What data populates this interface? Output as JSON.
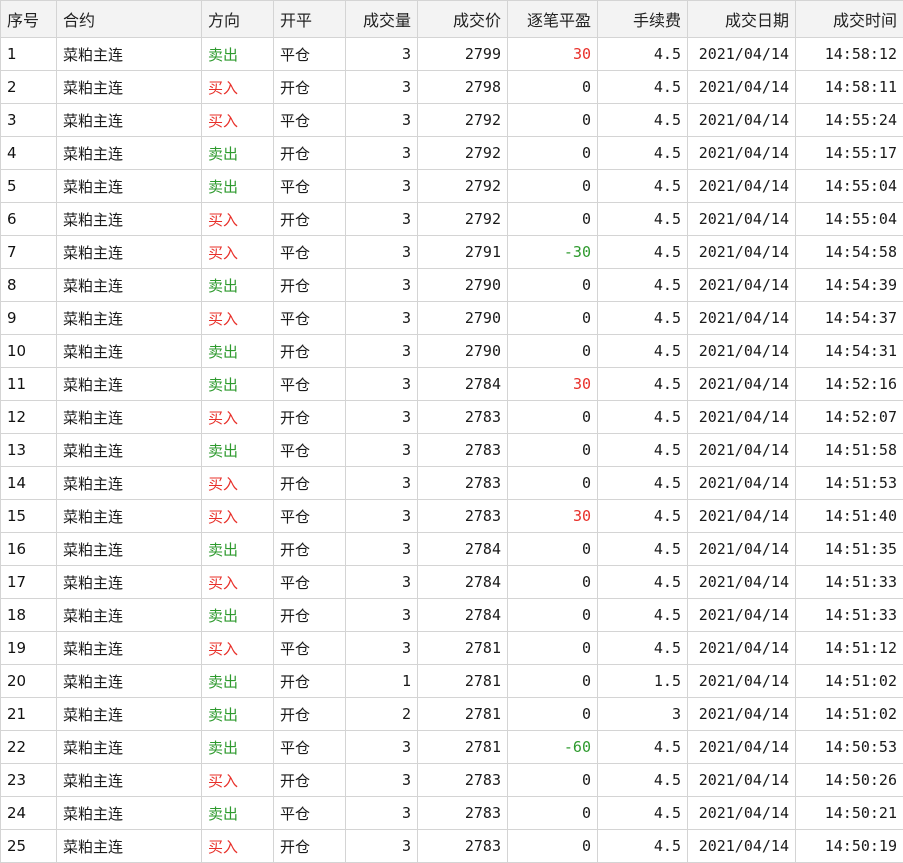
{
  "columns": [
    "序号",
    "合约",
    "方向",
    "开平",
    "成交量",
    "成交价",
    "逐笔平盈",
    "手续费",
    "成交日期",
    "成交时间"
  ],
  "colors": {
    "buy": "#e8302a",
    "sell": "#2e9a2e"
  },
  "rows": [
    {
      "seq": "1",
      "contract": "菜粕主连",
      "dir": "卖出",
      "oc": "平仓",
      "vol": "3",
      "price": "2799",
      "pnl": "30",
      "fee": "4.5",
      "date": "2021/04/14",
      "time": "14:58:12"
    },
    {
      "seq": "2",
      "contract": "菜粕主连",
      "dir": "买入",
      "oc": "开仓",
      "vol": "3",
      "price": "2798",
      "pnl": "0",
      "fee": "4.5",
      "date": "2021/04/14",
      "time": "14:58:11"
    },
    {
      "seq": "3",
      "contract": "菜粕主连",
      "dir": "买入",
      "oc": "平仓",
      "vol": "3",
      "price": "2792",
      "pnl": "0",
      "fee": "4.5",
      "date": "2021/04/14",
      "time": "14:55:24"
    },
    {
      "seq": "4",
      "contract": "菜粕主连",
      "dir": "卖出",
      "oc": "开仓",
      "vol": "3",
      "price": "2792",
      "pnl": "0",
      "fee": "4.5",
      "date": "2021/04/14",
      "time": "14:55:17"
    },
    {
      "seq": "5",
      "contract": "菜粕主连",
      "dir": "卖出",
      "oc": "平仓",
      "vol": "3",
      "price": "2792",
      "pnl": "0",
      "fee": "4.5",
      "date": "2021/04/14",
      "time": "14:55:04"
    },
    {
      "seq": "6",
      "contract": "菜粕主连",
      "dir": "买入",
      "oc": "开仓",
      "vol": "3",
      "price": "2792",
      "pnl": "0",
      "fee": "4.5",
      "date": "2021/04/14",
      "time": "14:55:04"
    },
    {
      "seq": "7",
      "contract": "菜粕主连",
      "dir": "买入",
      "oc": "平仓",
      "vol": "3",
      "price": "2791",
      "pnl": "-30",
      "fee": "4.5",
      "date": "2021/04/14",
      "time": "14:54:58"
    },
    {
      "seq": "8",
      "contract": "菜粕主连",
      "dir": "卖出",
      "oc": "开仓",
      "vol": "3",
      "price": "2790",
      "pnl": "0",
      "fee": "4.5",
      "date": "2021/04/14",
      "time": "14:54:39"
    },
    {
      "seq": "9",
      "contract": "菜粕主连",
      "dir": "买入",
      "oc": "平仓",
      "vol": "3",
      "price": "2790",
      "pnl": "0",
      "fee": "4.5",
      "date": "2021/04/14",
      "time": "14:54:37"
    },
    {
      "seq": "10",
      "contract": "菜粕主连",
      "dir": "卖出",
      "oc": "开仓",
      "vol": "3",
      "price": "2790",
      "pnl": "0",
      "fee": "4.5",
      "date": "2021/04/14",
      "time": "14:54:31"
    },
    {
      "seq": "11",
      "contract": "菜粕主连",
      "dir": "卖出",
      "oc": "平仓",
      "vol": "3",
      "price": "2784",
      "pnl": "30",
      "fee": "4.5",
      "date": "2021/04/14",
      "time": "14:52:16"
    },
    {
      "seq": "12",
      "contract": "菜粕主连",
      "dir": "买入",
      "oc": "开仓",
      "vol": "3",
      "price": "2783",
      "pnl": "0",
      "fee": "4.5",
      "date": "2021/04/14",
      "time": "14:52:07"
    },
    {
      "seq": "13",
      "contract": "菜粕主连",
      "dir": "卖出",
      "oc": "平仓",
      "vol": "3",
      "price": "2783",
      "pnl": "0",
      "fee": "4.5",
      "date": "2021/04/14",
      "time": "14:51:58"
    },
    {
      "seq": "14",
      "contract": "菜粕主连",
      "dir": "买入",
      "oc": "开仓",
      "vol": "3",
      "price": "2783",
      "pnl": "0",
      "fee": "4.5",
      "date": "2021/04/14",
      "time": "14:51:53"
    },
    {
      "seq": "15",
      "contract": "菜粕主连",
      "dir": "买入",
      "oc": "平仓",
      "vol": "3",
      "price": "2783",
      "pnl": "30",
      "fee": "4.5",
      "date": "2021/04/14",
      "time": "14:51:40"
    },
    {
      "seq": "16",
      "contract": "菜粕主连",
      "dir": "卖出",
      "oc": "开仓",
      "vol": "3",
      "price": "2784",
      "pnl": "0",
      "fee": "4.5",
      "date": "2021/04/14",
      "time": "14:51:35"
    },
    {
      "seq": "17",
      "contract": "菜粕主连",
      "dir": "买入",
      "oc": "平仓",
      "vol": "3",
      "price": "2784",
      "pnl": "0",
      "fee": "4.5",
      "date": "2021/04/14",
      "time": "14:51:33"
    },
    {
      "seq": "18",
      "contract": "菜粕主连",
      "dir": "卖出",
      "oc": "开仓",
      "vol": "3",
      "price": "2784",
      "pnl": "0",
      "fee": "4.5",
      "date": "2021/04/14",
      "time": "14:51:33"
    },
    {
      "seq": "19",
      "contract": "菜粕主连",
      "dir": "买入",
      "oc": "平仓",
      "vol": "3",
      "price": "2781",
      "pnl": "0",
      "fee": "4.5",
      "date": "2021/04/14",
      "time": "14:51:12"
    },
    {
      "seq": "20",
      "contract": "菜粕主连",
      "dir": "卖出",
      "oc": "开仓",
      "vol": "1",
      "price": "2781",
      "pnl": "0",
      "fee": "1.5",
      "date": "2021/04/14",
      "time": "14:51:02"
    },
    {
      "seq": "21",
      "contract": "菜粕主连",
      "dir": "卖出",
      "oc": "开仓",
      "vol": "2",
      "price": "2781",
      "pnl": "0",
      "fee": "3",
      "date": "2021/04/14",
      "time": "14:51:02"
    },
    {
      "seq": "22",
      "contract": "菜粕主连",
      "dir": "卖出",
      "oc": "平仓",
      "vol": "3",
      "price": "2781",
      "pnl": "-60",
      "fee": "4.5",
      "date": "2021/04/14",
      "time": "14:50:53"
    },
    {
      "seq": "23",
      "contract": "菜粕主连",
      "dir": "买入",
      "oc": "开仓",
      "vol": "3",
      "price": "2783",
      "pnl": "0",
      "fee": "4.5",
      "date": "2021/04/14",
      "time": "14:50:26"
    },
    {
      "seq": "24",
      "contract": "菜粕主连",
      "dir": "卖出",
      "oc": "平仓",
      "vol": "3",
      "price": "2783",
      "pnl": "0",
      "fee": "4.5",
      "date": "2021/04/14",
      "time": "14:50:21"
    },
    {
      "seq": "25",
      "contract": "菜粕主连",
      "dir": "买入",
      "oc": "开仓",
      "vol": "3",
      "price": "2783",
      "pnl": "0",
      "fee": "4.5",
      "date": "2021/04/14",
      "time": "14:50:19"
    }
  ]
}
